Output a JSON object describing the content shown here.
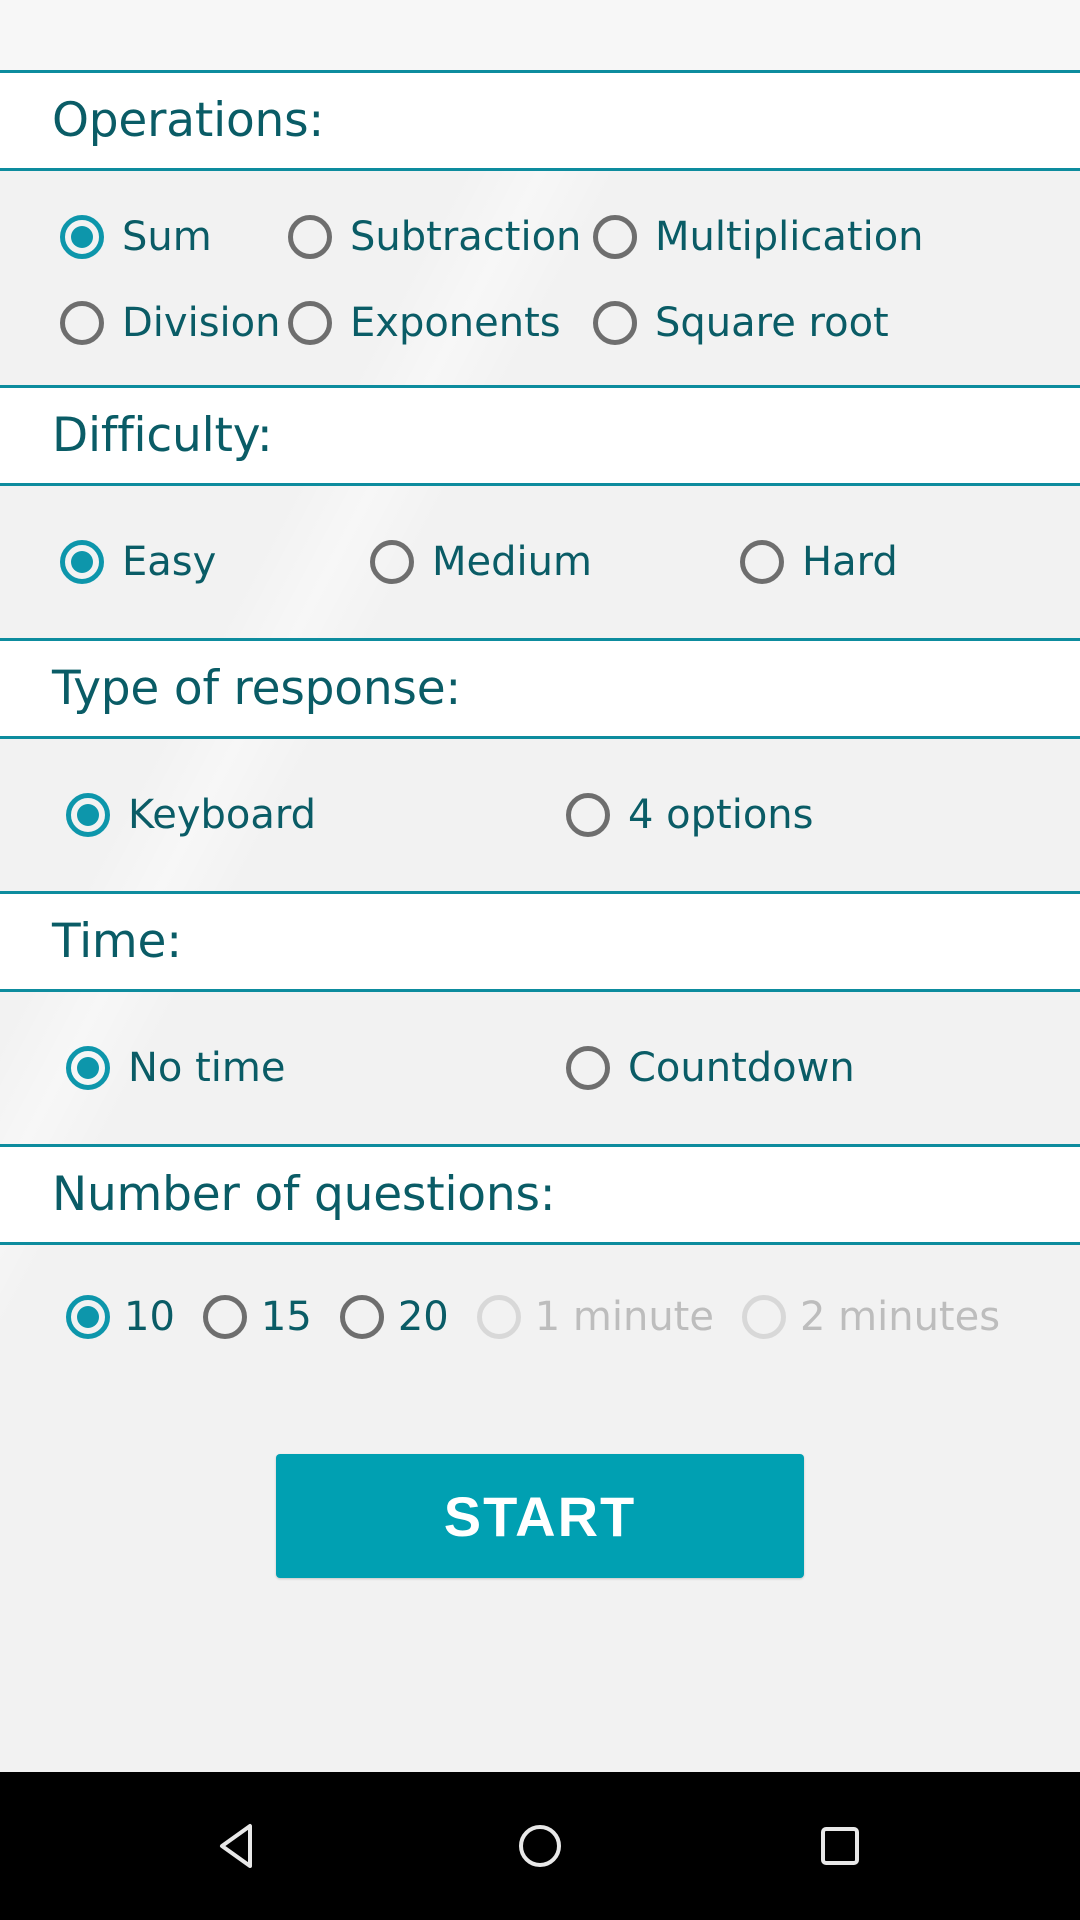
{
  "app": {
    "accent_color": "#0d96ab",
    "header_text_color": "#0a5c66",
    "disabled_color": "#bdbdbd",
    "button_color": "#00a0b2"
  },
  "sections": [
    {
      "key": "operations",
      "title": "Operations:",
      "rows": [
        [
          {
            "label": "Sum",
            "checked": true,
            "disabled": false
          },
          {
            "label": "Subtraction",
            "checked": false,
            "disabled": false
          },
          {
            "label": "Multiplication",
            "checked": false,
            "disabled": false
          }
        ],
        [
          {
            "label": "Division",
            "checked": false,
            "disabled": false
          },
          {
            "label": "Exponents",
            "checked": false,
            "disabled": false
          },
          {
            "label": "Square root",
            "checked": false,
            "disabled": false
          }
        ]
      ]
    },
    {
      "key": "difficulty",
      "title": "Difficulty:",
      "rows": [
        [
          {
            "label": "Easy",
            "checked": true,
            "disabled": false
          },
          {
            "label": "Medium",
            "checked": false,
            "disabled": false
          },
          {
            "label": "Hard",
            "checked": false,
            "disabled": false
          }
        ]
      ]
    },
    {
      "key": "type_of_response",
      "title": "Type of response:",
      "rows": [
        [
          {
            "label": "Keyboard",
            "checked": true,
            "disabled": false
          },
          {
            "label": "4 options",
            "checked": false,
            "disabled": false
          }
        ]
      ]
    },
    {
      "key": "time",
      "title": "Time:",
      "rows": [
        [
          {
            "label": "No time",
            "checked": true,
            "disabled": false
          },
          {
            "label": "Countdown",
            "checked": false,
            "disabled": false
          }
        ]
      ]
    },
    {
      "key": "number_of_questions",
      "title": "Number of questions:",
      "rows": [
        [
          {
            "label": "10",
            "checked": true,
            "disabled": false
          },
          {
            "label": "15",
            "checked": false,
            "disabled": false
          },
          {
            "label": "20",
            "checked": false,
            "disabled": false
          },
          {
            "label": "1 minute",
            "checked": false,
            "disabled": true
          },
          {
            "label": "2 minutes",
            "checked": false,
            "disabled": true
          }
        ]
      ]
    }
  ],
  "start_button": {
    "label": "START"
  },
  "navbar": {
    "back": "back-icon",
    "home": "home-icon",
    "recents": "recents-icon"
  }
}
